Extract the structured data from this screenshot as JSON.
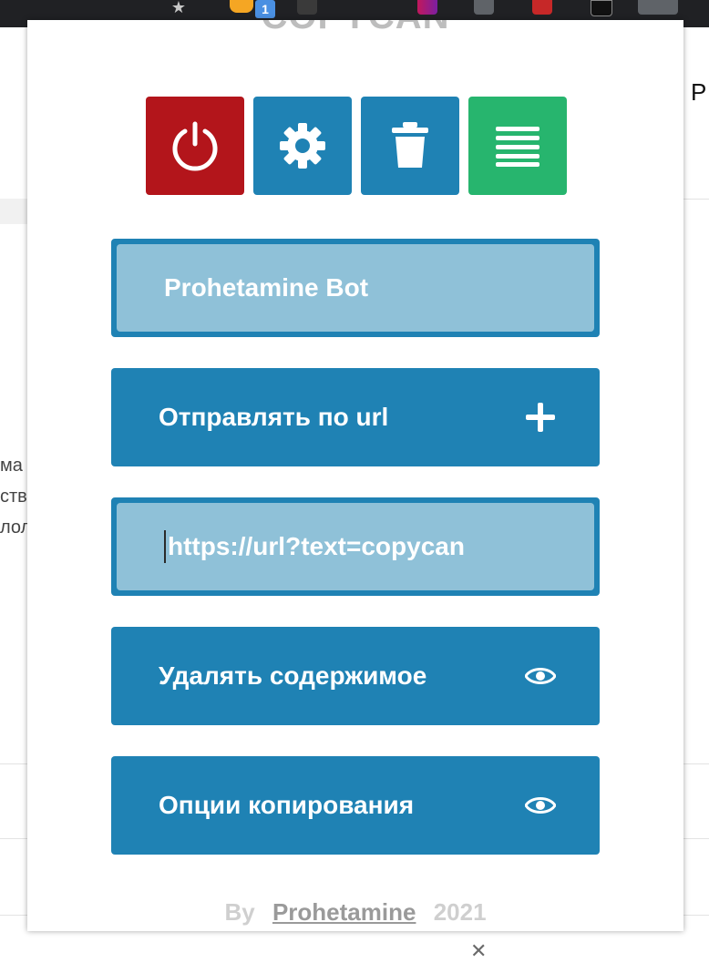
{
  "browser": {
    "badge_count": "1"
  },
  "background_page": {
    "heading_fragment": "P",
    "text_lines": [
      "ма",
      "ств",
      "лол"
    ]
  },
  "popup": {
    "title": "COPYCAN",
    "toolbar": {
      "power_color": "#b3151b",
      "settings_color": "#1f82b4",
      "trash_color": "#1f82b4",
      "menu_color": "#27b56e"
    },
    "bot_name_input": {
      "value": "Prohetamine Bot"
    },
    "send_by_url": {
      "label": "Отправлять по url",
      "icon": "plus-icon"
    },
    "url_input": {
      "value": "https://url?text=copycan"
    },
    "delete_content": {
      "label": "Удалять содержимое",
      "icon": "eye-icon"
    },
    "copy_options": {
      "label": "Опции копирования",
      "icon": "eye-icon"
    },
    "footer": {
      "by": "By",
      "author": "Prohetamine",
      "year": "2021"
    }
  }
}
